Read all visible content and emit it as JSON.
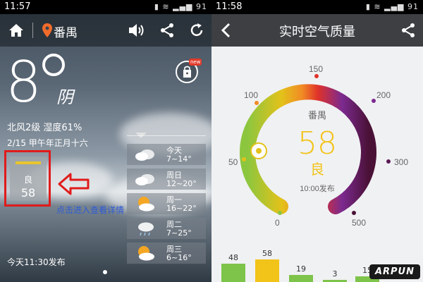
{
  "left": {
    "status": {
      "time": "11:57",
      "battery": "91"
    },
    "toolbar": {
      "city": "番禺"
    },
    "weather": {
      "temp": "8",
      "condition": "阴",
      "wind_humidity": "北风2级 湿度61%",
      "date": "2/15 甲午年正月十六"
    },
    "aqi": {
      "level": "良",
      "value": "58"
    },
    "hint": "点击进入查看详情",
    "shop_badge": "new",
    "forecast": [
      {
        "day": "今天",
        "range": "7~14°",
        "icon": "cloudy-icon"
      },
      {
        "day": "周日",
        "range": "12~20°",
        "icon": "cloudy-icon"
      },
      {
        "day": "周一",
        "range": "16~22°",
        "icon": "partly-sunny-icon"
      },
      {
        "day": "周二",
        "range": "7~25°",
        "icon": "rain-icon"
      },
      {
        "day": "周三",
        "range": "6~16°",
        "icon": "partly-sunny-icon"
      }
    ],
    "published": "今天11:30发布"
  },
  "right": {
    "status": {
      "time": "11:58",
      "battery": "91"
    },
    "title": "实时空气质量",
    "gauge": {
      "city": "番禺",
      "value": "58",
      "level": "良",
      "published": "10:00发布",
      "ticks": [
        "0",
        "50",
        "100",
        "150",
        "200",
        "300",
        "500"
      ]
    },
    "history": [
      {
        "label": "48",
        "value": 48,
        "color": "#7ec34a"
      },
      {
        "label": "58",
        "value": 58,
        "color": "#f2c318"
      },
      {
        "label": "19",
        "value": 19,
        "color": "#7ec34a"
      },
      {
        "label": "3",
        "value": 3,
        "color": "#7ec34a"
      },
      {
        "label": "15",
        "value": 15,
        "color": "#7ec34a"
      }
    ],
    "watermark": "ARPUN"
  }
}
